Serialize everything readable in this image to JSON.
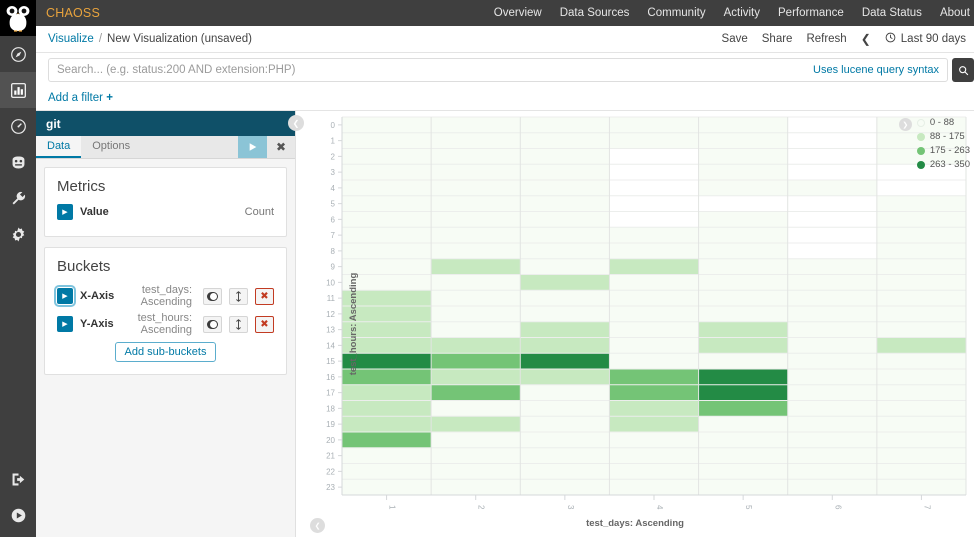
{
  "topnav": {
    "brand": "CHAOSS",
    "links": [
      "Overview",
      "Data Sources",
      "Community",
      "Activity",
      "Performance",
      "Data Status",
      "About"
    ]
  },
  "breadcrumb": {
    "root": "Visualize",
    "separator": "/",
    "current": "New Visualization (unsaved)",
    "save": "Save",
    "share": "Share",
    "refresh": "Refresh",
    "prev_icon": "chevron-left-icon",
    "clock_icon": "clock-icon",
    "time_range": "Last 90 days"
  },
  "search": {
    "placeholder": "Search... (e.g. status:200 AND extension:PHP)",
    "value": "",
    "lucene_hint": "Uses lucene query syntax",
    "submit_icon": "search-icon",
    "add_filter": "Add a filter",
    "add_filter_plus": "+"
  },
  "sidebar_rail": {
    "items": [
      {
        "name": "owl-logo-icon",
        "label": "CHAOSS logo"
      },
      {
        "name": "compass-icon",
        "label": "Discover"
      },
      {
        "name": "bar-chart-icon",
        "label": "Visualize"
      },
      {
        "name": "clock-dashboard-icon",
        "label": "Dashboard"
      },
      {
        "name": "timelion-icon",
        "label": "Timelion"
      },
      {
        "name": "wrench-icon",
        "label": "Dev Tools"
      },
      {
        "name": "gear-icon",
        "label": "Management"
      },
      {
        "name": "logout-icon",
        "label": "Log out"
      },
      {
        "name": "play-circle-icon",
        "label": "Collapse"
      }
    ]
  },
  "editor": {
    "title": "git",
    "tabs": [
      {
        "label": "Data",
        "active": true
      },
      {
        "label": "Options",
        "active": false
      }
    ],
    "apply_icon": "play-icon",
    "close_icon": "close-icon",
    "collapse_icon": "chevron-left-icon",
    "metrics": {
      "heading": "Metrics",
      "rows": [
        {
          "expand_icon": "caret-right-icon",
          "label": "Value",
          "value": "Count"
        }
      ]
    },
    "buckets": {
      "heading": "Buckets",
      "rows": [
        {
          "expand_icon": "caret-right-icon",
          "label": "X-Axis",
          "description": "test_days: Ascending",
          "toggle_icon": "toggle-on-icon",
          "move_icon": "move-vertical-icon",
          "remove_icon": "remove-icon",
          "remove_label": "✖"
        },
        {
          "expand_icon": "caret-right-icon",
          "label": "Y-Axis",
          "description": "test_hours: Ascending",
          "toggle_icon": "toggle-on-icon",
          "move_icon": "move-vertical-icon",
          "remove_icon": "remove-icon",
          "remove_label": "✖"
        }
      ],
      "add_sub_buckets": "Add sub-buckets"
    }
  },
  "visualization": {
    "legend_toggle_icon": "chevron-right-icon",
    "bottom_collapse_icon": "chevron-up-icon"
  },
  "chart_data": {
    "type": "heatmap",
    "title": "",
    "xlabel": "test_days: Ascending",
    "ylabel": "test_hours: Ascending",
    "x_categories": [
      "1",
      "2",
      "3",
      "4",
      "5",
      "6",
      "7"
    ],
    "y_categories": [
      "0",
      "1",
      "2",
      "3",
      "4",
      "5",
      "6",
      "7",
      "8",
      "9",
      "10",
      "11",
      "12",
      "13",
      "14",
      "15",
      "16",
      "17",
      "18",
      "19",
      "20",
      "21",
      "22",
      "23"
    ],
    "legend_position": "right",
    "legend": [
      {
        "label": "0 - 88",
        "color": "#f7fcf5",
        "min": 0,
        "max": 88
      },
      {
        "label": "88 - 175",
        "color": "#c7e9c0",
        "min": 88,
        "max": 175
      },
      {
        "label": "175 - 263",
        "color": "#74c476",
        "min": 175,
        "max": 263
      },
      {
        "label": "263 - 350",
        "color": "#238b45",
        "min": 263,
        "max": 350
      }
    ],
    "grid": true,
    "zlim": [
      0,
      350
    ],
    "cells": [
      {
        "x": "1",
        "y": "0",
        "bin": 0
      },
      {
        "x": "1",
        "y": "1",
        "bin": 0
      },
      {
        "x": "1",
        "y": "2",
        "bin": 0
      },
      {
        "x": "1",
        "y": "3",
        "bin": 0
      },
      {
        "x": "1",
        "y": "4",
        "bin": 0
      },
      {
        "x": "1",
        "y": "5",
        "bin": 0
      },
      {
        "x": "1",
        "y": "6",
        "bin": 0
      },
      {
        "x": "1",
        "y": "7",
        "bin": 0
      },
      {
        "x": "1",
        "y": "8",
        "bin": 0
      },
      {
        "x": "1",
        "y": "9",
        "bin": 0
      },
      {
        "x": "1",
        "y": "10",
        "bin": 0
      },
      {
        "x": "1",
        "y": "11",
        "bin": 1
      },
      {
        "x": "1",
        "y": "12",
        "bin": 1
      },
      {
        "x": "1",
        "y": "13",
        "bin": 1
      },
      {
        "x": "1",
        "y": "14",
        "bin": 1
      },
      {
        "x": "1",
        "y": "15",
        "bin": 3
      },
      {
        "x": "1",
        "y": "16",
        "bin": 2
      },
      {
        "x": "1",
        "y": "17",
        "bin": 1
      },
      {
        "x": "1",
        "y": "18",
        "bin": 1
      },
      {
        "x": "1",
        "y": "19",
        "bin": 1
      },
      {
        "x": "1",
        "y": "20",
        "bin": 2
      },
      {
        "x": "1",
        "y": "21",
        "bin": 0
      },
      {
        "x": "1",
        "y": "22",
        "bin": 0
      },
      {
        "x": "1",
        "y": "23",
        "bin": 0
      },
      {
        "x": "2",
        "y": "0",
        "bin": 0
      },
      {
        "x": "2",
        "y": "1",
        "bin": 0
      },
      {
        "x": "2",
        "y": "2",
        "bin": 0
      },
      {
        "x": "2",
        "y": "3",
        "bin": 0
      },
      {
        "x": "2",
        "y": "4",
        "bin": 0
      },
      {
        "x": "2",
        "y": "5",
        "bin": 0
      },
      {
        "x": "2",
        "y": "6",
        "bin": 0
      },
      {
        "x": "2",
        "y": "7",
        "bin": 0
      },
      {
        "x": "2",
        "y": "8",
        "bin": 0
      },
      {
        "x": "2",
        "y": "9",
        "bin": 1
      },
      {
        "x": "2",
        "y": "10",
        "bin": 0
      },
      {
        "x": "2",
        "y": "11",
        "bin": 0
      },
      {
        "x": "2",
        "y": "12",
        "bin": 0
      },
      {
        "x": "2",
        "y": "13",
        "bin": 0
      },
      {
        "x": "2",
        "y": "14",
        "bin": 1
      },
      {
        "x": "2",
        "y": "15",
        "bin": 2
      },
      {
        "x": "2",
        "y": "16",
        "bin": 1
      },
      {
        "x": "2",
        "y": "17",
        "bin": 2
      },
      {
        "x": "2",
        "y": "18",
        "bin": 0
      },
      {
        "x": "2",
        "y": "19",
        "bin": 1
      },
      {
        "x": "2",
        "y": "20",
        "bin": 0
      },
      {
        "x": "2",
        "y": "21",
        "bin": 0
      },
      {
        "x": "2",
        "y": "22",
        "bin": 0
      },
      {
        "x": "2",
        "y": "23",
        "bin": 0
      },
      {
        "x": "3",
        "y": "0",
        "bin": 0
      },
      {
        "x": "3",
        "y": "1",
        "bin": 0
      },
      {
        "x": "3",
        "y": "2",
        "bin": 0
      },
      {
        "x": "3",
        "y": "3",
        "bin": 0
      },
      {
        "x": "3",
        "y": "4",
        "bin": 0
      },
      {
        "x": "3",
        "y": "5",
        "bin": 0
      },
      {
        "x": "3",
        "y": "6",
        "bin": 0
      },
      {
        "x": "3",
        "y": "7",
        "bin": 0
      },
      {
        "x": "3",
        "y": "8",
        "bin": 0
      },
      {
        "x": "3",
        "y": "9",
        "bin": 0
      },
      {
        "x": "3",
        "y": "10",
        "bin": 1
      },
      {
        "x": "3",
        "y": "11",
        "bin": 0
      },
      {
        "x": "3",
        "y": "12",
        "bin": 0
      },
      {
        "x": "3",
        "y": "13",
        "bin": 1
      },
      {
        "x": "3",
        "y": "14",
        "bin": 1
      },
      {
        "x": "3",
        "y": "15",
        "bin": 3
      },
      {
        "x": "3",
        "y": "16",
        "bin": 1
      },
      {
        "x": "3",
        "y": "17",
        "bin": 0
      },
      {
        "x": "3",
        "y": "18",
        "bin": 0
      },
      {
        "x": "3",
        "y": "19",
        "bin": 0
      },
      {
        "x": "3",
        "y": "20",
        "bin": 0
      },
      {
        "x": "3",
        "y": "21",
        "bin": 0
      },
      {
        "x": "3",
        "y": "22",
        "bin": 0
      },
      {
        "x": "3",
        "y": "23",
        "bin": 0
      },
      {
        "x": "4",
        "y": "0",
        "bin": 0
      },
      {
        "x": "4",
        "y": "1",
        "bin": 0
      },
      {
        "x": "4",
        "y": "2",
        "bin": -1
      },
      {
        "x": "4",
        "y": "3",
        "bin": -1
      },
      {
        "x": "4",
        "y": "4",
        "bin": -1
      },
      {
        "x": "4",
        "y": "5",
        "bin": -1
      },
      {
        "x": "4",
        "y": "6",
        "bin": -1
      },
      {
        "x": "4",
        "y": "7",
        "bin": 0
      },
      {
        "x": "4",
        "y": "8",
        "bin": 0
      },
      {
        "x": "4",
        "y": "9",
        "bin": 1
      },
      {
        "x": "4",
        "y": "10",
        "bin": 0
      },
      {
        "x": "4",
        "y": "11",
        "bin": 0
      },
      {
        "x": "4",
        "y": "12",
        "bin": 0
      },
      {
        "x": "4",
        "y": "13",
        "bin": 0
      },
      {
        "x": "4",
        "y": "14",
        "bin": 0
      },
      {
        "x": "4",
        "y": "15",
        "bin": 0
      },
      {
        "x": "4",
        "y": "16",
        "bin": 2
      },
      {
        "x": "4",
        "y": "17",
        "bin": 2
      },
      {
        "x": "4",
        "y": "18",
        "bin": 1
      },
      {
        "x": "4",
        "y": "19",
        "bin": 1
      },
      {
        "x": "4",
        "y": "20",
        "bin": 0
      },
      {
        "x": "4",
        "y": "21",
        "bin": 0
      },
      {
        "x": "4",
        "y": "22",
        "bin": 0
      },
      {
        "x": "4",
        "y": "23",
        "bin": 0
      },
      {
        "x": "5",
        "y": "0",
        "bin": 0
      },
      {
        "x": "5",
        "y": "1",
        "bin": 0
      },
      {
        "x": "5",
        "y": "2",
        "bin": 0
      },
      {
        "x": "5",
        "y": "3",
        "bin": 0
      },
      {
        "x": "5",
        "y": "4",
        "bin": 0
      },
      {
        "x": "5",
        "y": "5",
        "bin": -1
      },
      {
        "x": "5",
        "y": "6",
        "bin": 0
      },
      {
        "x": "5",
        "y": "7",
        "bin": 0
      },
      {
        "x": "5",
        "y": "8",
        "bin": 0
      },
      {
        "x": "5",
        "y": "9",
        "bin": 0
      },
      {
        "x": "5",
        "y": "10",
        "bin": 0
      },
      {
        "x": "5",
        "y": "11",
        "bin": 0
      },
      {
        "x": "5",
        "y": "12",
        "bin": 0
      },
      {
        "x": "5",
        "y": "13",
        "bin": 1
      },
      {
        "x": "5",
        "y": "14",
        "bin": 1
      },
      {
        "x": "5",
        "y": "15",
        "bin": 0
      },
      {
        "x": "5",
        "y": "16",
        "bin": 3
      },
      {
        "x": "5",
        "y": "17",
        "bin": 3
      },
      {
        "x": "5",
        "y": "18",
        "bin": 2
      },
      {
        "x": "5",
        "y": "19",
        "bin": 0
      },
      {
        "x": "5",
        "y": "20",
        "bin": 0
      },
      {
        "x": "5",
        "y": "21",
        "bin": 0
      },
      {
        "x": "5",
        "y": "22",
        "bin": 0
      },
      {
        "x": "5",
        "y": "23",
        "bin": 0
      },
      {
        "x": "6",
        "y": "0",
        "bin": -1
      },
      {
        "x": "6",
        "y": "1",
        "bin": -1
      },
      {
        "x": "6",
        "y": "2",
        "bin": -1
      },
      {
        "x": "6",
        "y": "3",
        "bin": -1
      },
      {
        "x": "6",
        "y": "4",
        "bin": 0
      },
      {
        "x": "6",
        "y": "5",
        "bin": -1
      },
      {
        "x": "6",
        "y": "6",
        "bin": -1
      },
      {
        "x": "6",
        "y": "7",
        "bin": -1
      },
      {
        "x": "6",
        "y": "8",
        "bin": -1
      },
      {
        "x": "6",
        "y": "9",
        "bin": 0
      },
      {
        "x": "6",
        "y": "10",
        "bin": 0
      },
      {
        "x": "6",
        "y": "11",
        "bin": 0
      },
      {
        "x": "6",
        "y": "12",
        "bin": 0
      },
      {
        "x": "6",
        "y": "13",
        "bin": 0
      },
      {
        "x": "6",
        "y": "14",
        "bin": 0
      },
      {
        "x": "6",
        "y": "15",
        "bin": 0
      },
      {
        "x": "6",
        "y": "16",
        "bin": 0
      },
      {
        "x": "6",
        "y": "17",
        "bin": 0
      },
      {
        "x": "6",
        "y": "18",
        "bin": 0
      },
      {
        "x": "6",
        "y": "19",
        "bin": 0
      },
      {
        "x": "6",
        "y": "20",
        "bin": 0
      },
      {
        "x": "6",
        "y": "21",
        "bin": 0
      },
      {
        "x": "6",
        "y": "22",
        "bin": 0
      },
      {
        "x": "6",
        "y": "23",
        "bin": 0
      },
      {
        "x": "7",
        "y": "0",
        "bin": 0
      },
      {
        "x": "7",
        "y": "1",
        "bin": 0
      },
      {
        "x": "7",
        "y": "2",
        "bin": 0
      },
      {
        "x": "7",
        "y": "3",
        "bin": -1
      },
      {
        "x": "7",
        "y": "4",
        "bin": -1
      },
      {
        "x": "7",
        "y": "5",
        "bin": 0
      },
      {
        "x": "7",
        "y": "6",
        "bin": 0
      },
      {
        "x": "7",
        "y": "7",
        "bin": 0
      },
      {
        "x": "7",
        "y": "8",
        "bin": 0
      },
      {
        "x": "7",
        "y": "9",
        "bin": 0
      },
      {
        "x": "7",
        "y": "10",
        "bin": 0
      },
      {
        "x": "7",
        "y": "11",
        "bin": 0
      },
      {
        "x": "7",
        "y": "12",
        "bin": 0
      },
      {
        "x": "7",
        "y": "13",
        "bin": 0
      },
      {
        "x": "7",
        "y": "14",
        "bin": 1
      },
      {
        "x": "7",
        "y": "15",
        "bin": 0
      },
      {
        "x": "7",
        "y": "16",
        "bin": 0
      },
      {
        "x": "7",
        "y": "17",
        "bin": 0
      },
      {
        "x": "7",
        "y": "18",
        "bin": 0
      },
      {
        "x": "7",
        "y": "19",
        "bin": 0
      },
      {
        "x": "7",
        "y": "20",
        "bin": 0
      },
      {
        "x": "7",
        "y": "21",
        "bin": 0
      },
      {
        "x": "7",
        "y": "22",
        "bin": 0
      },
      {
        "x": "7",
        "y": "23",
        "bin": 0
      }
    ]
  }
}
